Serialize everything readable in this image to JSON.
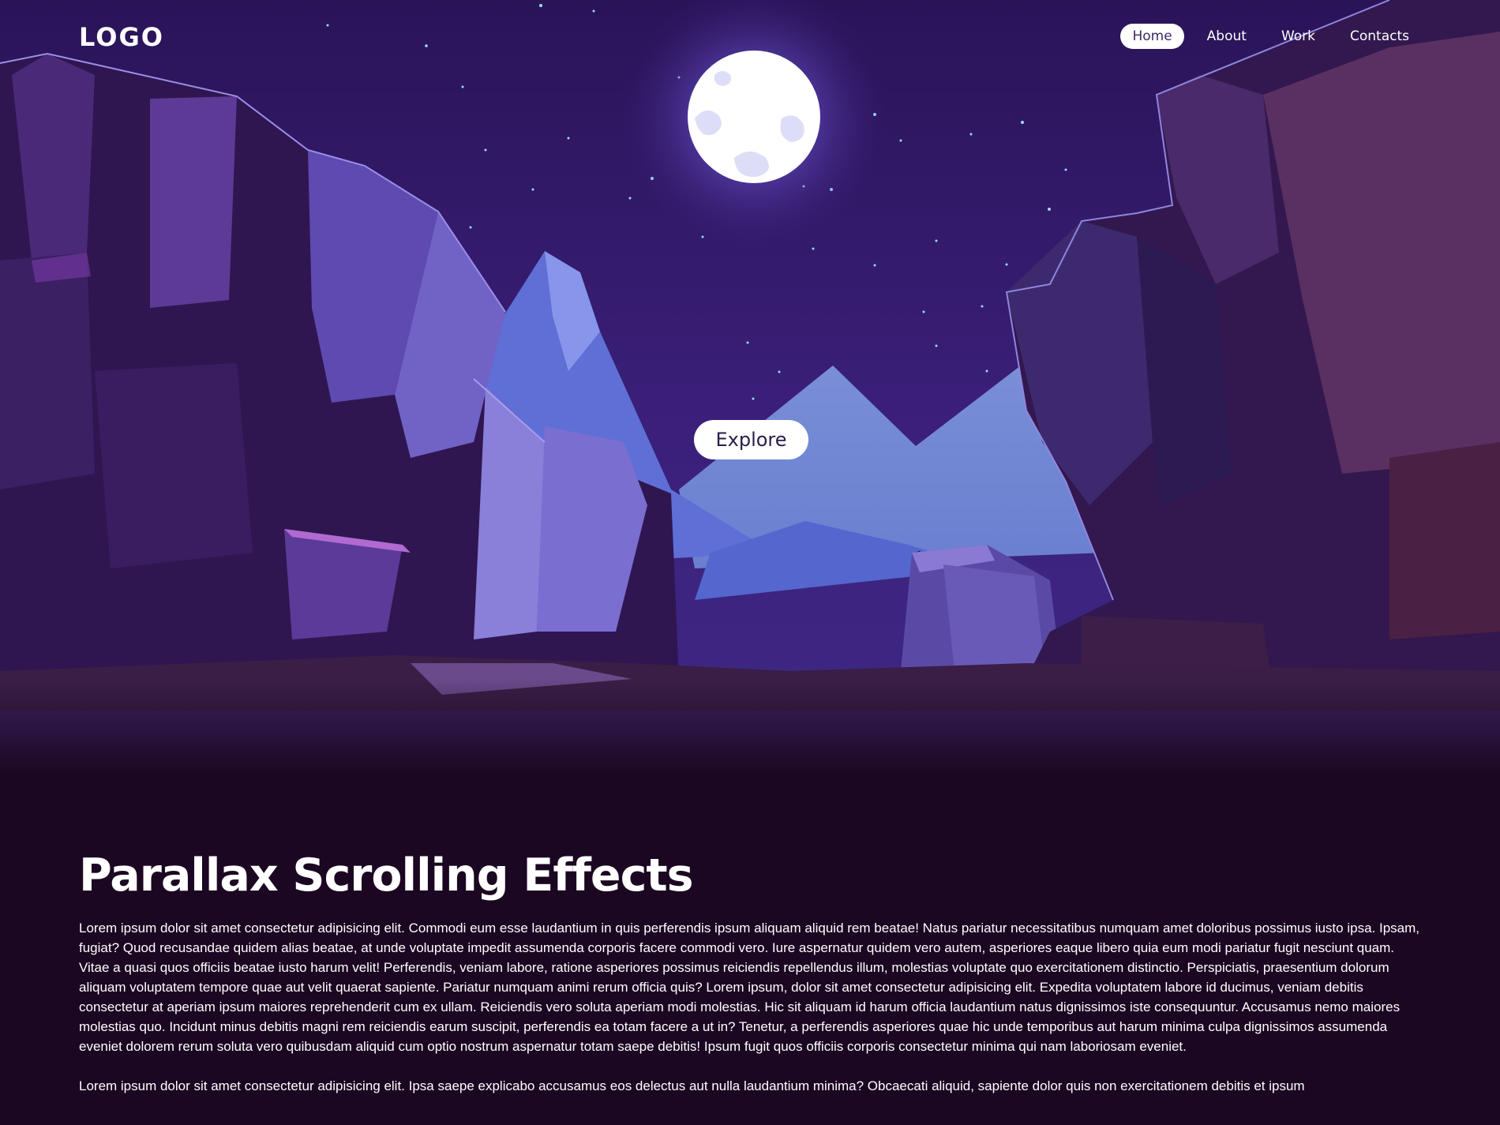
{
  "header": {
    "logo": "LOGO",
    "nav": [
      {
        "label": "Home",
        "active": true
      },
      {
        "label": "About",
        "active": false
      },
      {
        "label": "Work",
        "active": false
      },
      {
        "label": "Contacts",
        "active": false
      }
    ]
  },
  "hero": {
    "cta_label": "Explore"
  },
  "content": {
    "title": "Parallax Scrolling Effects",
    "paragraphs": [
      "Lorem ipsum dolor sit amet consectetur adipisicing elit. Commodi eum esse laudantium in quis perferendis ipsum aliquam aliquid rem beatae! Natus pariatur necessitatibus numquam amet doloribus possimus iusto ipsa. Ipsam, fugiat? Quod recusandae quidem alias beatae, at unde voluptate impedit assumenda corporis facere commodi vero. Iure aspernatur quidem vero autem, asperiores eaque libero quia eum modi pariatur fugit nesciunt quam. Vitae a quasi quos officiis beatae iusto harum velit! Perferendis, veniam labore, ratione asperiores possimus reiciendis repellendus illum, molestias voluptate quo exercitationem distinctio. Perspiciatis, praesentium dolorum aliquam voluptatem tempore quae aut velit quaerat sapiente. Pariatur numquam animi rerum officia quis? Lorem ipsum, dolor sit amet consectetur adipisicing elit. Expedita voluptatem labore id ducimus, veniam debitis consectetur at aperiam ipsum maiores reprehenderit cum ex ullam. Reiciendis vero soluta aperiam modi molestias. Hic sit aliquam id harum officia laudantium natus dignissimos iste consequuntur. Accusamus nemo maiores molestias quo. Incidunt minus debitis magni rem reiciendis earum suscipit, perferendis ea totam facere a ut in? Tenetur, a perferendis asperiores quae hic unde temporibus aut harum minima culpa dignissimos assumenda eveniet dolorem rerum soluta vero quibusdam aliquid cum optio nostrum aspernatur totam saepe debitis! Ipsum fugit quos officiis corporis consectetur minima qui nam laboriosam eveniet.",
      "Lorem ipsum dolor sit amet consectetur adipisicing elit. Ipsa saepe explicabo accusamus eos delectus aut nulla laudantium minima? Obcaecati aliquid, sapiente dolor quis non exercitationem debitis et ipsum"
    ]
  },
  "colors": {
    "sky": "#2a1458",
    "moon": "#ffffff",
    "page_background": "#1c0722",
    "nav_active_bg": "#ffffff",
    "nav_active_text": "#3b2a63"
  },
  "icons": []
}
